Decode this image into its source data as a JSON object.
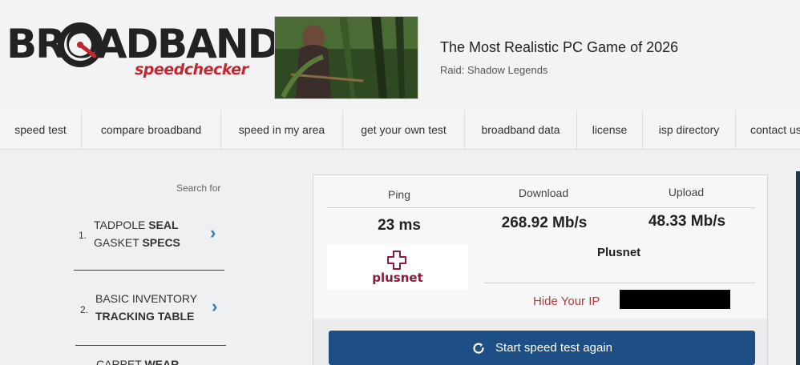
{
  "header": {
    "logo_main": "BROADBAND",
    "logo_sub": "speedchecker",
    "ad": {
      "title": "The Most Realistic PC Game of 2026",
      "subtitle": "Raid: Shadow Legends"
    }
  },
  "nav": {
    "items": [
      {
        "label": "speed test"
      },
      {
        "label": "compare broadband"
      },
      {
        "label": "speed in my area"
      },
      {
        "label": "get your own test"
      },
      {
        "label": "broadband data"
      },
      {
        "label": "license"
      },
      {
        "label": "isp directory"
      },
      {
        "label": "contact us"
      }
    ]
  },
  "sidebar": {
    "search_for": "Search for",
    "ads": [
      {
        "num": "1.",
        "line1_a": "TADPOLE ",
        "line1_b": "SEAL",
        "line2_a": "GASKET ",
        "line2_b": "SPECS"
      },
      {
        "num": "2.",
        "line1_a": "BASIC INVENTORY",
        "line1_b": "",
        "line2_a": "",
        "line2_b": "TRACKING TABLE"
      },
      {
        "num": "",
        "line1_a": "CARPET ",
        "line1_b": "WEAR",
        "line2_a": "",
        "line2_b": ""
      }
    ]
  },
  "results": {
    "ping_label": "Ping",
    "download_label": "Download",
    "upload_label": "Upload",
    "ping_value": "23 ms",
    "download_value": "268.92 Mb/s",
    "upload_value": "48.33 Mb/s",
    "isp_logo_text": "plusnet",
    "isp_name": "Plusnet",
    "hide_ip_label": "Hide Your IP",
    "start_button_label": "Start speed test again"
  },
  "colors": {
    "brand_red": "#c0282d",
    "button_blue": "#1d4f86",
    "chevron_blue": "#2e7db8",
    "plusnet_purple": "#8a1a3c"
  }
}
